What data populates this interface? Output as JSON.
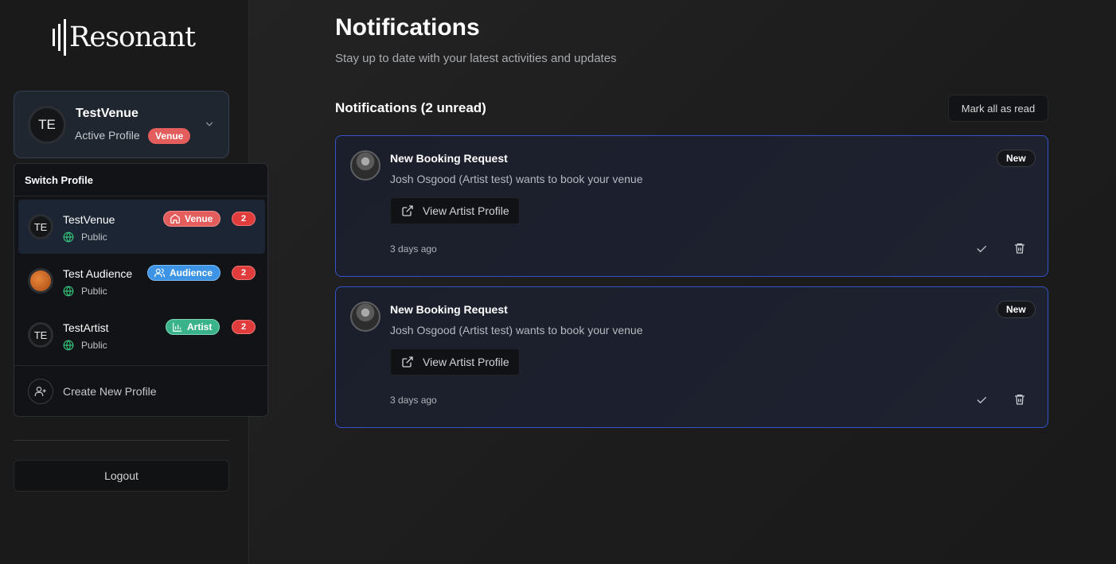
{
  "brand": {
    "name": "Resonant"
  },
  "active_profile": {
    "initials": "TE",
    "name": "TestVenue",
    "label": "Active Profile",
    "badge": "Venue"
  },
  "switch_menu": {
    "title": "Switch Profile",
    "items": [
      {
        "initials": "TE",
        "name": "TestVenue",
        "visibility": "Public",
        "type": "Venue",
        "count": "2"
      },
      {
        "initials": "",
        "name": "Test Audience",
        "visibility": "Public",
        "type": "Audience",
        "count": "2"
      },
      {
        "initials": "TE",
        "name": "TestArtist",
        "visibility": "Public",
        "type": "Artist",
        "count": "2"
      }
    ],
    "create_label": "Create New Profile"
  },
  "logout_label": "Logout",
  "page": {
    "title": "Notifications",
    "subtitle": "Stay up to date with your latest activities and updates",
    "section_title": "Notifications (2 unread)",
    "mark_all_label": "Mark all as read"
  },
  "notifications": [
    {
      "title": "New Booking Request",
      "message": "Josh Osgood (Artist test) wants to book your venue",
      "badge": "New",
      "action_label": "View Artist Profile",
      "time": "3 days ago"
    },
    {
      "title": "New Booking Request",
      "message": "Josh Osgood (Artist test) wants to book your venue",
      "badge": "New",
      "action_label": "View Artist Profile",
      "time": "3 days ago"
    }
  ],
  "colors": {
    "venue": "#e35d5d",
    "audience": "#3d94e4",
    "artist": "#3bb38a",
    "count_badge": "#e03c3c",
    "card_border": "#3552c9"
  }
}
